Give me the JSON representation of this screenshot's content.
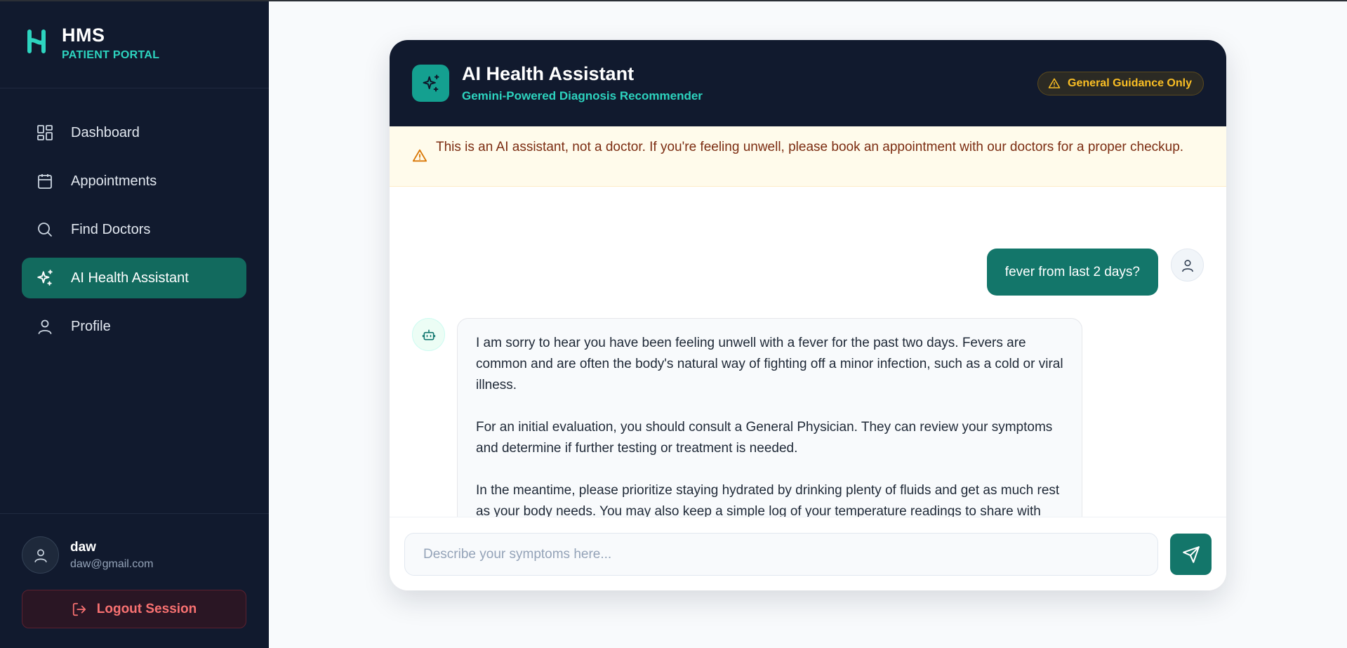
{
  "brand": {
    "title": "HMS",
    "subtitle": "PATIENT PORTAL"
  },
  "nav": {
    "items": [
      {
        "label": "Dashboard",
        "icon": "dashboard-grid-icon",
        "active": false
      },
      {
        "label": "Appointments",
        "icon": "calendar-icon",
        "active": false
      },
      {
        "label": "Find Doctors",
        "icon": "search-icon",
        "active": false
      },
      {
        "label": "AI Health Assistant",
        "icon": "sparkles-icon",
        "active": true
      },
      {
        "label": "Profile",
        "icon": "user-icon",
        "active": false
      }
    ]
  },
  "user": {
    "name": "daw",
    "email": "daw@gmail.com"
  },
  "logout_label": "Logout Session",
  "chat": {
    "title": "AI Health Assistant",
    "subtitle": "Gemini-Powered Diagnosis Recommender",
    "badge": "General Guidance Only",
    "warning": "This is an AI assistant, not a doctor. If you're feeling unwell, please book an appointment with our doctors for a proper checkup.",
    "user_message": "fever from last 2 days?",
    "bot_paragraphs": [
      "I am sorry to hear you have been feeling unwell with a fever for the past two days. Fevers are common and are often the body's natural way of fighting off a minor infection, such as a cold or viral illness.",
      "For an initial evaluation, you should consult a General Physician. They can review your symptoms and determine if further testing or treatment is needed.",
      "In the meantime, please prioritize staying hydrated by drinking plenty of fluids and get as much rest as your body needs. You may also keep a simple log of your temperature readings to share with your doctor."
    ],
    "input_placeholder": "Describe your symptoms here...",
    "input_value": ""
  },
  "colors": {
    "sidebar_bg": "#111a2e",
    "accent_teal": "#13766a",
    "brand_teal": "#2dd4bf",
    "warning_amber": "#fbbf24",
    "danger_red": "#f87171"
  }
}
